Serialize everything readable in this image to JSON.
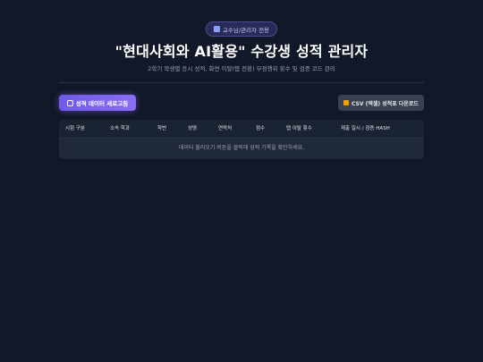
{
  "badge": {
    "icon": "chart-icon",
    "label": "교수님/관리자 전용"
  },
  "header": {
    "title": "\"현대사회와 AI활용\" 수강생 성적 관리자",
    "subtitle": "2학기 학생별 응시 성적, 화면 이탈(탭 전환) 부정행위 횟수 및 검증 코드 관리"
  },
  "toolbar": {
    "refresh_label": "성적 데이터 새로고침",
    "refresh_icon": "refresh-icon",
    "csv_label": "CSV (엑셀) 성적표 다운로드",
    "csv_icon": "download-icon"
  },
  "table": {
    "columns": [
      "시험 구분",
      "소속 학과",
      "학번",
      "성명",
      "연락처",
      "점수",
      "탭 이탈 횟수",
      "제출 일시 / 검증 HASH"
    ],
    "empty_message": "데이터 불러오기 버튼을 클릭해 성적 기록을 확인하세요."
  },
  "colors": {
    "background": "#111827",
    "accent": "#7c5cf0",
    "panel": "#1f2937"
  }
}
